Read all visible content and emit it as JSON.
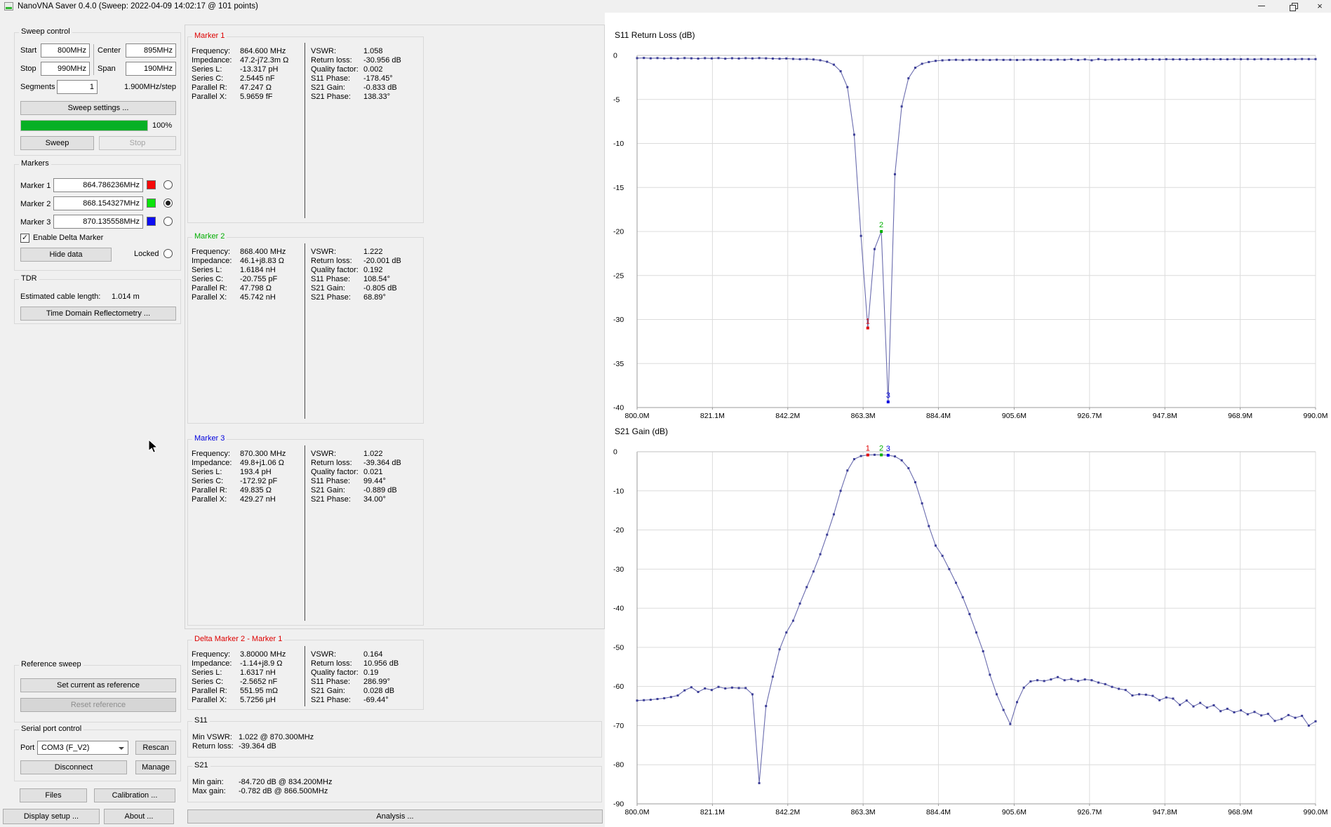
{
  "window": {
    "title": "NanoVNA Saver 0.4.0 (Sweep: 2022-04-09 14:02:17 @ 101 points)"
  },
  "sweep_control": {
    "legend": "Sweep control",
    "start_label": "Start",
    "start_value": "800MHz",
    "stop_label": "Stop",
    "stop_value": "990MHz",
    "center_label": "Center",
    "center_value": "895MHz",
    "span_label": "Span",
    "span_value": "190MHz",
    "segments_label": "Segments",
    "segments_value": "1",
    "step_text": "1.900MHz/step",
    "sweep_settings_label": "Sweep settings ...",
    "progress_percent": "100%",
    "sweep_label": "Sweep",
    "stop_button_label": "Stop"
  },
  "markers_panel": {
    "legend": "Markers",
    "rows": [
      {
        "label": "Marker 1",
        "value": "864.786236MHz",
        "color": "#f60909",
        "selected": false
      },
      {
        "label": "Marker 2",
        "value": "868.154327MHz",
        "color": "#0be30b",
        "selected": true
      },
      {
        "label": "Marker 3",
        "value": "870.135558MHz",
        "color": "#0d0df2",
        "selected": false
      }
    ],
    "enable_delta_label": "Enable Delta Marker",
    "enable_delta_checked": true,
    "hide_data_label": "Hide data",
    "locked_label": "Locked",
    "locked_selected": false
  },
  "tdr": {
    "legend": "TDR",
    "cable_length_label": "Estimated cable length:",
    "cable_length_value": "1.014 m",
    "button_label": "Time Domain Reflectometry ..."
  },
  "reference_sweep": {
    "legend": "Reference sweep",
    "set_label": "Set current as reference",
    "reset_label": "Reset reference"
  },
  "serial": {
    "legend": "Serial port control",
    "port_label": "Port",
    "port_value": "COM3 (F_V2)",
    "rescan_label": "Rescan",
    "disconnect_label": "Disconnect",
    "manage_label": "Manage"
  },
  "bottom_buttons": {
    "files": "Files",
    "calibration": "Calibration ...",
    "display_setup": "Display setup ...",
    "about": "About ...",
    "analysis": "Analysis ..."
  },
  "marker_details": [
    {
      "title": "Marker 1",
      "title_color": "#dd0000",
      "left": [
        [
          "Frequency:",
          "864.600 MHz"
        ],
        [
          "Impedance:",
          "47.2-j72.3m Ω"
        ],
        [
          "Series L:",
          "-13.317 pH"
        ],
        [
          "Series C:",
          "2.5445 nF"
        ],
        [
          "Parallel R:",
          "47.247 Ω"
        ],
        [
          "Parallel X:",
          "5.9659 fF"
        ]
      ],
      "right": [
        [
          "VSWR:",
          "1.058"
        ],
        [
          "Return loss:",
          "-30.956 dB"
        ],
        [
          "Quality factor:",
          "0.002"
        ],
        [
          "S11 Phase:",
          "-178.45°"
        ],
        [
          "S21 Gain:",
          "-0.833 dB"
        ],
        [
          "S21 Phase:",
          "138.33°"
        ]
      ]
    },
    {
      "title": "Marker 2",
      "title_color": "#00ad00",
      "left": [
        [
          "Frequency:",
          "868.400 MHz"
        ],
        [
          "Impedance:",
          "46.1+j8.83 Ω"
        ],
        [
          "Series L:",
          "1.6184 nH"
        ],
        [
          "Series C:",
          "-20.755 pF"
        ],
        [
          "Parallel R:",
          "47.798 Ω"
        ],
        [
          "Parallel X:",
          "45.742 nH"
        ]
      ],
      "right": [
        [
          "VSWR:",
          "1.222"
        ],
        [
          "Return loss:",
          "-20.001 dB"
        ],
        [
          "Quality factor:",
          "0.192"
        ],
        [
          "S11 Phase:",
          "108.54°"
        ],
        [
          "S21 Gain:",
          "-0.805 dB"
        ],
        [
          "S21 Phase:",
          "68.89°"
        ]
      ]
    },
    {
      "title": "Marker 3",
      "title_color": "#0000dd",
      "left": [
        [
          "Frequency:",
          "870.300 MHz"
        ],
        [
          "Impedance:",
          "49.8+j1.06 Ω"
        ],
        [
          "Series L:",
          "193.4 pH"
        ],
        [
          "Series C:",
          "-172.92 pF"
        ],
        [
          "Parallel R:",
          "49.835 Ω"
        ],
        [
          "Parallel X:",
          "429.27 nH"
        ]
      ],
      "right": [
        [
          "VSWR:",
          "1.022"
        ],
        [
          "Return loss:",
          "-39.364 dB"
        ],
        [
          "Quality factor:",
          "0.021"
        ],
        [
          "S11 Phase:",
          "99.44°"
        ],
        [
          "S21 Gain:",
          "-0.889 dB"
        ],
        [
          "S21 Phase:",
          "34.00°"
        ]
      ]
    },
    {
      "title": "Delta Marker 2 - Marker 1",
      "title_color": "#dd0000",
      "left": [
        [
          "Frequency:",
          "3.80000 MHz"
        ],
        [
          "Impedance:",
          "-1.14+j8.9 Ω"
        ],
        [
          "Series L:",
          "1.6317 nH"
        ],
        [
          "Series C:",
          "-2.5652 nF"
        ],
        [
          "Parallel R:",
          "551.95 mΩ"
        ],
        [
          "Parallel X:",
          "5.7256 μH"
        ]
      ],
      "right": [
        [
          "VSWR:",
          "0.164"
        ],
        [
          "Return loss:",
          "10.956 dB"
        ],
        [
          "Quality factor:",
          "0.19"
        ],
        [
          "S11 Phase:",
          "286.99°"
        ],
        [
          "S21 Gain:",
          "0.028 dB"
        ],
        [
          "S21 Phase:",
          "-69.44°"
        ]
      ]
    }
  ],
  "s11_stats": {
    "title": "S11",
    "rows": [
      [
        "Min VSWR:",
        "1.022 @ 870.300MHz"
      ],
      [
        "Return loss:",
        "-39.364 dB"
      ]
    ]
  },
  "s21_stats": {
    "title": "S21",
    "rows": [
      [
        "Min gain:",
        "-84.720 dB @ 834.200MHz"
      ],
      [
        "Max gain:",
        "-0.782 dB @ 866.500MHz"
      ]
    ]
  },
  "chart_data": [
    {
      "type": "line",
      "title": "S11 Return Loss (dB)",
      "xlim": [
        800,
        990
      ],
      "ylim": [
        -40,
        0
      ],
      "x_start": 800,
      "x_step": 1.9,
      "line_color": "#6a6cae",
      "point_color": "#3c3e97",
      "y_ticks": [
        0,
        -5,
        -10,
        -15,
        -20,
        -25,
        -30,
        -35,
        -40
      ],
      "x_ticks": [
        {
          "f": 800,
          "label": "800.0M"
        },
        {
          "f": 821.1,
          "label": "821.1M"
        },
        {
          "f": 842.2,
          "label": "842.2M"
        },
        {
          "f": 863.3,
          "label": "863.3M"
        },
        {
          "f": 884.4,
          "label": "884.4M"
        },
        {
          "f": 905.6,
          "label": "905.6M"
        },
        {
          "f": 926.7,
          "label": "926.7M"
        },
        {
          "f": 947.8,
          "label": "947.8M"
        },
        {
          "f": 968.9,
          "label": "968.9M"
        },
        {
          "f": 990,
          "label": "990.0M"
        }
      ],
      "values": [
        -0.31,
        -0.29,
        -0.33,
        -0.3,
        -0.34,
        -0.31,
        -0.35,
        -0.3,
        -0.33,
        -0.36,
        -0.31,
        -0.34,
        -0.3,
        -0.37,
        -0.32,
        -0.35,
        -0.31,
        -0.34,
        -0.3,
        -0.33,
        -0.36,
        -0.38,
        -0.35,
        -0.4,
        -0.43,
        -0.41,
        -0.46,
        -0.55,
        -0.72,
        -1.05,
        -1.8,
        -3.6,
        -9.0,
        -20.5,
        -30.96,
        -22.0,
        -20.0,
        -39.36,
        -13.5,
        -5.8,
        -2.6,
        -1.4,
        -0.95,
        -0.75,
        -0.62,
        -0.56,
        -0.52,
        -0.5,
        -0.53,
        -0.49,
        -0.52,
        -0.5,
        -0.52,
        -0.49,
        -0.51,
        -0.5,
        -0.52,
        -0.5,
        -0.48,
        -0.51,
        -0.49,
        -0.52,
        -0.47,
        -0.5,
        -0.43,
        -0.52,
        -0.45,
        -0.55,
        -0.42,
        -0.5,
        -0.46,
        -0.48,
        -0.45,
        -0.47,
        -0.44,
        -0.46,
        -0.44,
        -0.46,
        -0.43,
        -0.45,
        -0.44,
        -0.46,
        -0.43,
        -0.45,
        -0.42,
        -0.44,
        -0.43,
        -0.44,
        -0.42,
        -0.43,
        -0.42,
        -0.44,
        -0.41,
        -0.43,
        -0.42,
        -0.43,
        -0.42,
        -0.43,
        -0.41,
        -0.42,
        -0.42
      ],
      "markers": [
        {
          "label": "1",
          "freq": 864.6,
          "color": "#e00000"
        },
        {
          "label": "2",
          "freq": 868.4,
          "color": "#00b000"
        },
        {
          "label": "3",
          "freq": 870.3,
          "color": "#0000e0"
        }
      ]
    },
    {
      "type": "line",
      "title": "S21 Gain (dB)",
      "xlim": [
        800,
        990
      ],
      "ylim": [
        -90,
        0
      ],
      "x_start": 800,
      "x_step": 1.9,
      "line_color": "#6a6cae",
      "point_color": "#3c3e97",
      "y_ticks": [
        0,
        -10,
        -20,
        -30,
        -40,
        -50,
        -60,
        -70,
        -80,
        -90
      ],
      "x_ticks": [
        {
          "f": 800,
          "label": "800.0M"
        },
        {
          "f": 821.1,
          "label": "821.1M"
        },
        {
          "f": 842.2,
          "label": "842.2M"
        },
        {
          "f": 863.3,
          "label": "863.3M"
        },
        {
          "f": 884.4,
          "label": "884.4M"
        },
        {
          "f": 905.6,
          "label": "905.6M"
        },
        {
          "f": 926.7,
          "label": "926.7M"
        },
        {
          "f": 947.8,
          "label": "947.8M"
        },
        {
          "f": 968.9,
          "label": "968.9M"
        },
        {
          "f": 990,
          "label": "990.0M"
        }
      ],
      "values": [
        -63.6,
        -63.5,
        -63.4,
        -63.2,
        -63.0,
        -62.7,
        -62.3,
        -61.0,
        -60.2,
        -61.4,
        -60.5,
        -60.9,
        -60.1,
        -60.5,
        -60.3,
        -60.4,
        -60.4,
        -62.0,
        -84.7,
        -65.0,
        -57.5,
        -50.5,
        -46.2,
        -43.2,
        -38.8,
        -34.6,
        -30.6,
        -26.2,
        -21.2,
        -16.0,
        -10.0,
        -4.8,
        -1.9,
        -1.1,
        -0.83,
        -0.78,
        -0.81,
        -0.89,
        -1.2,
        -2.2,
        -4.2,
        -7.8,
        -13.2,
        -19.0,
        -24.0,
        -26.6,
        -30.0,
        -33.5,
        -37.2,
        -41.5,
        -46.2,
        -51.0,
        -57.0,
        -62.0,
        -66.0,
        -69.6,
        -64.0,
        -60.3,
        -58.7,
        -58.4,
        -58.6,
        -58.2,
        -57.6,
        -58.4,
        -58.1,
        -58.6,
        -58.2,
        -58.4,
        -59.0,
        -59.4,
        -60.1,
        -60.6,
        -60.9,
        -62.3,
        -62.0,
        -62.1,
        -62.4,
        -63.5,
        -62.8,
        -63.1,
        -64.7,
        -63.6,
        -65.1,
        -64.2,
        -65.4,
        -64.8,
        -66.3,
        -65.7,
        -66.6,
        -66.1,
        -67.1,
        -66.5,
        -67.4,
        -67.0,
        -68.8,
        -68.3,
        -67.3,
        -68.0,
        -67.5,
        -70.0,
        -68.9
      ],
      "markers": [
        {
          "label": "1",
          "freq": 864.6,
          "color": "#e00000"
        },
        {
          "label": "2",
          "freq": 868.4,
          "color": "#00b000"
        },
        {
          "label": "3",
          "freq": 870.3,
          "color": "#0000e0"
        }
      ]
    }
  ]
}
